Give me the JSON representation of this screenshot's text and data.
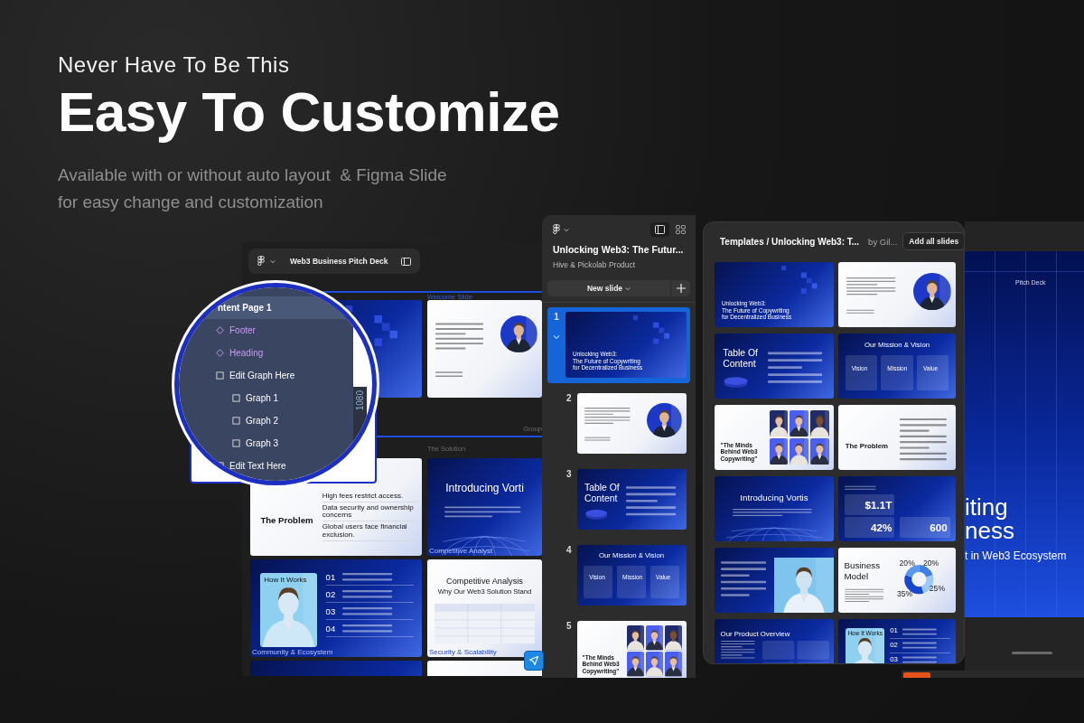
{
  "hero": {
    "eyebrow": "Never Have To Be This",
    "title": "Easy To Customize",
    "subtitle_lines": [
      "Available with or without auto layout  & Figma Slide",
      "for easy change and customization"
    ]
  },
  "canvas": {
    "toolbar_title": "Web3 Business Pitch Deck",
    "rows": [
      {
        "kind": "header",
        "text": "Welcome Slide",
        "right_aligned": false,
        "rule_above": true,
        "rule_below": false
      },
      {
        "kind": "slides",
        "slides": [
          {
            "kind": "cover"
          },
          {
            "kind": "quote"
          }
        ]
      },
      {
        "kind": "header",
        "text": "Group",
        "right_aligned": true,
        "rule_above": false,
        "rule_below": true
      },
      {
        "kind": "header",
        "text": "The Solution",
        "right_aligned": false,
        "rule_above": false,
        "rule_below": false
      },
      {
        "kind": "slides",
        "slides": [
          {
            "kind": "problem",
            "texts": [
              "The Problem",
              "High fees restrict access.",
              "Data security and ownership concerns",
              "Global users face financial exclusion."
            ]
          },
          {
            "kind": "intro",
            "texts": [
              "Introducing Vorti"
            ],
            "caption": "Competitive Analyst"
          }
        ]
      },
      {
        "kind": "slides",
        "slides": [
          {
            "kind": "how",
            "texts": [
              "How It Works",
              "01",
              "02",
              "03",
              "04"
            ],
            "caption": "Community & Ecosystem"
          },
          {
            "kind": "competitive",
            "texts": [
              "Competitive Analysis",
              "Why Our Web3 Solution Stand"
            ],
            "caption": "Security & Scalability"
          }
        ]
      },
      {
        "kind": "slides",
        "slides": [
          {
            "kind": "dark"
          },
          {
            "kind": "light"
          }
        ]
      }
    ]
  },
  "magnifier": {
    "dimension": "1080",
    "layers": [
      {
        "label": "ntent Page 1",
        "kind": "page"
      },
      {
        "label": "Footer",
        "kind": "component"
      },
      {
        "label": "Heading",
        "kind": "component"
      },
      {
        "label": "Edit Graph Here",
        "kind": "frame",
        "children": [
          {
            "label": "Graph 1",
            "kind": "frame"
          },
          {
            "label": "Graph 2",
            "kind": "frame"
          },
          {
            "label": "Graph 3",
            "kind": "frame"
          }
        ]
      },
      {
        "label": "Edit Text Here",
        "kind": "frame"
      }
    ]
  },
  "slides_panel": {
    "views": [
      {
        "kind": "list",
        "selected": true
      },
      {
        "kind": "grid",
        "selected": false
      }
    ],
    "title": "Unlocking Web3: The Futur...",
    "subtitle": "Hive & Pickolab Product",
    "new_slide": "New slide",
    "slides": [
      {
        "number": "1",
        "selected": true,
        "expanded": true,
        "thumb": {
          "kind": "cover",
          "texts": [
            "Unlocking Web3:",
            "The Future of Copywriting",
            "for Decentralized Business"
          ]
        }
      },
      {
        "number": "2",
        "selected": false,
        "expanded": false,
        "thumb": {
          "kind": "quote"
        }
      },
      {
        "number": "3",
        "selected": false,
        "expanded": false,
        "thumb": {
          "kind": "toc",
          "texts": [
            "Table Of Content"
          ]
        }
      },
      {
        "number": "4",
        "selected": false,
        "expanded": false,
        "thumb": {
          "kind": "mission",
          "texts": [
            "Our Mission & Vision",
            "Vision",
            "Mission",
            "Value"
          ]
        }
      },
      {
        "number": "5",
        "selected": false,
        "expanded": false,
        "thumb": {
          "kind": "team",
          "texts": [
            "\"The Minds Behind Web3 Copywriting\""
          ]
        }
      }
    ]
  },
  "templates": {
    "path": "Templates / Unlocking Web3: T...",
    "author": "by Gil...",
    "add_all": "Add all slides",
    "slides": [
      {
        "kind": "cover",
        "texts": [
          "Unlocking Web3:",
          "The Future of Copywriting",
          "for Decentralized Business"
        ]
      },
      {
        "kind": "quote"
      },
      {
        "kind": "toc",
        "texts": [
          "Table Of Content"
        ]
      },
      {
        "kind": "mission",
        "texts": [
          "Our Mission & Vision",
          "Vision",
          "Mission",
          "Value"
        ]
      },
      {
        "kind": "team",
        "texts": [
          "\"The Minds Behind Web3 Copywriting\""
        ]
      },
      {
        "kind": "problem",
        "texts": [
          "The Problem"
        ]
      },
      {
        "kind": "intro",
        "texts": [
          "Introducing Vortis"
        ]
      },
      {
        "kind": "stats",
        "texts": [
          "$1.1T",
          "42%",
          "600"
        ]
      },
      {
        "kind": "vr"
      },
      {
        "kind": "donut",
        "texts": [
          "Business Model"
        ],
        "chart_data": {
          "type": "donut",
          "values": [
            20,
            25,
            35,
            20
          ],
          "value_labels": [
            "20%",
            "25%",
            "35%",
            "20%"
          ]
        }
      },
      {
        "kind": "overview",
        "texts": [
          "Our Product Overview"
        ]
      },
      {
        "kind": "how",
        "texts": [
          "How It Works",
          "01",
          "02",
          "03"
        ]
      }
    ]
  },
  "presentation": {
    "header": "Pitch Deck",
    "title_lines": [
      "iting",
      "ness"
    ],
    "subtitle": "t in Web3 Ecosystem"
  }
}
